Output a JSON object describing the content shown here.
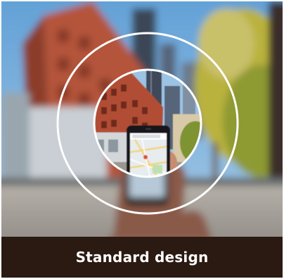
{
  "caption": {
    "label": "Standard design"
  },
  "colors": {
    "caption_bar": "#2b1a12",
    "caption_text": "#ffffff",
    "focus_ring": "#ffffff",
    "sky": "#7fb0d8",
    "brick": "#b04f34"
  },
  "icons": {
    "phone": "smartphone-map-icon",
    "rings": "focus-rings-icon"
  }
}
